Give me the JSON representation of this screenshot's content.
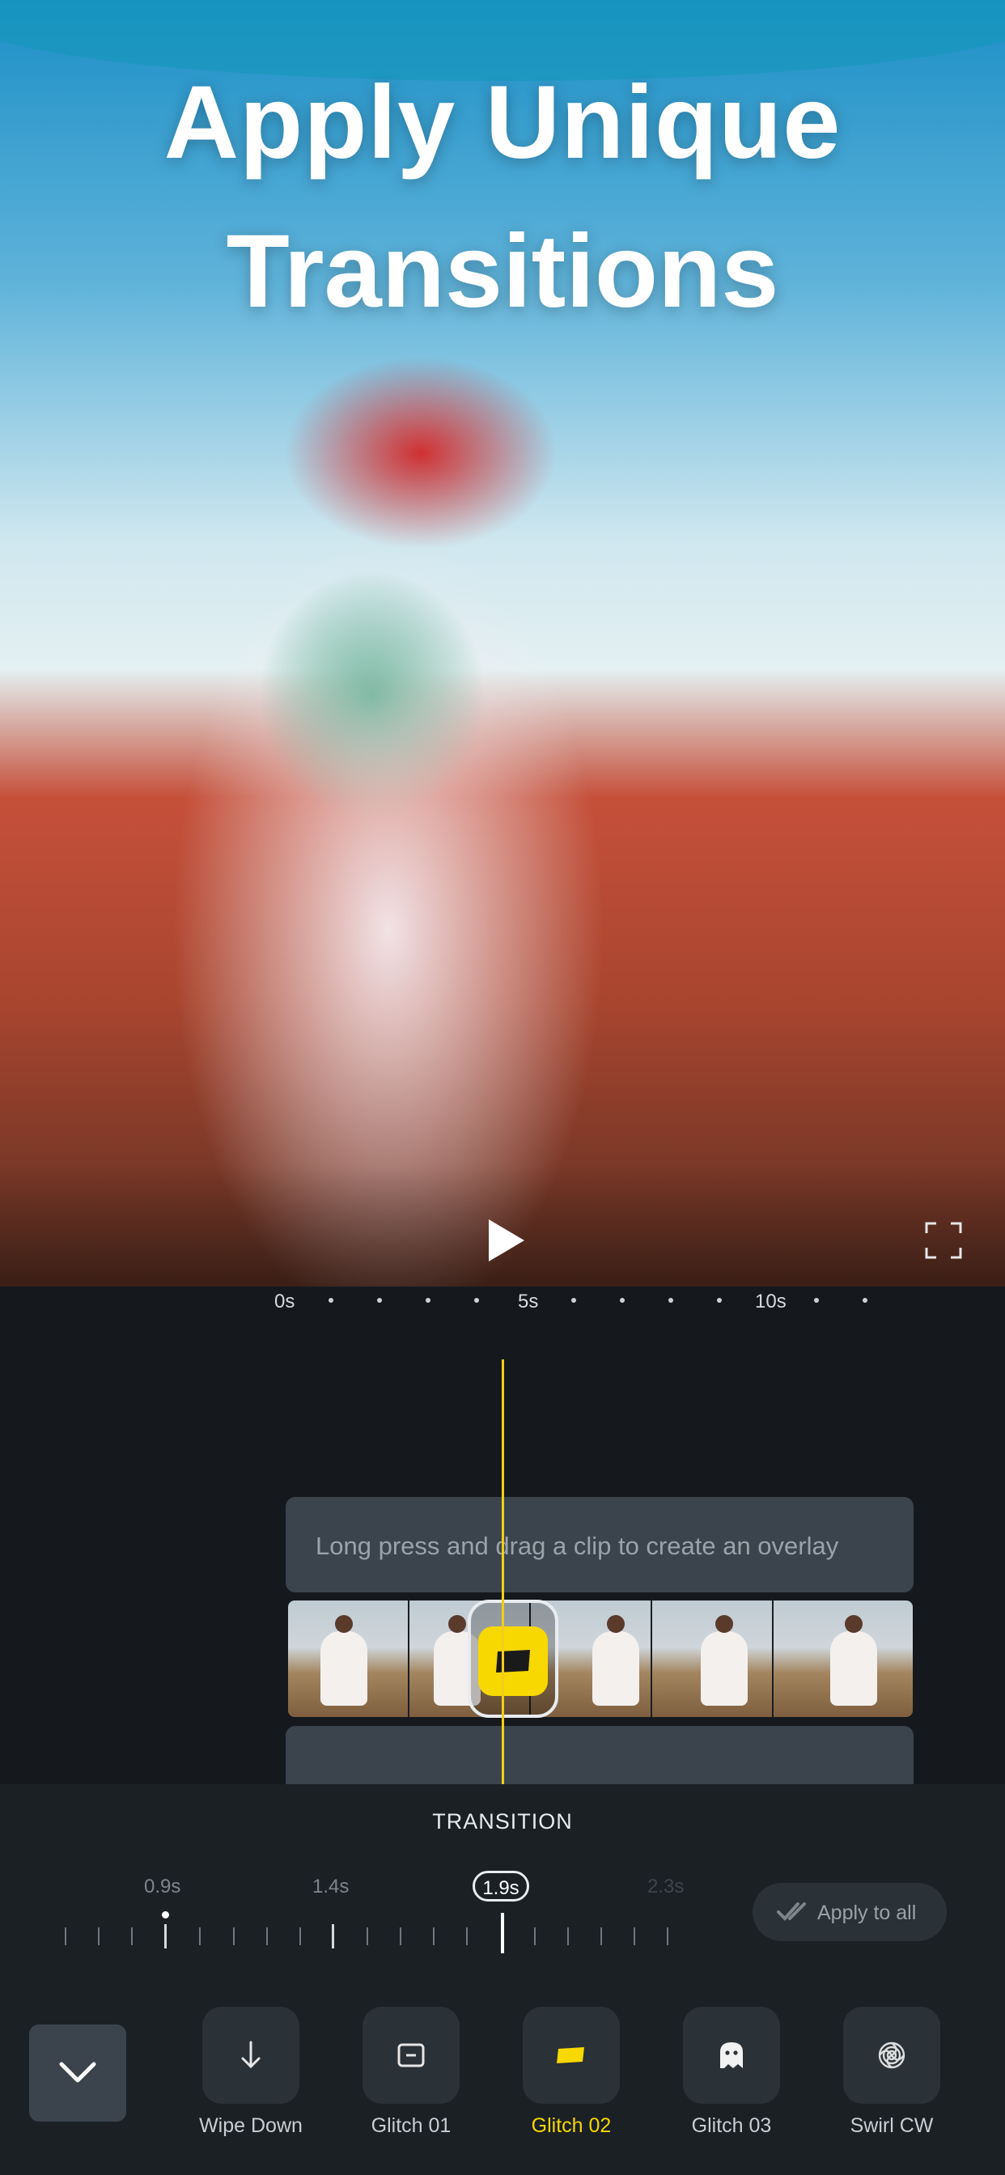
{
  "headline": {
    "line1": "Apply Unique",
    "line2": "Transitions"
  },
  "player": {
    "play_icon": "play-icon",
    "fullscreen_icon": "fullscreen-icon"
  },
  "ruler": {
    "labels": [
      "0s",
      "5s",
      "10s"
    ]
  },
  "timeline": {
    "overlay_hint": "Long press and drag a clip to create an overlay",
    "transition_marker_icon": "glitch-02-icon"
  },
  "panel": {
    "title": "TRANSITION",
    "durations": [
      "0.9s",
      "1.4s",
      "1.9s",
      "2.3s"
    ],
    "selected_duration": "1.9s",
    "apply_all": "Apply to all",
    "collapse_icon": "chevron-down-icon",
    "transitions": [
      {
        "label": "Wipe Down",
        "icon": "arrow-down-icon"
      },
      {
        "label": "Glitch 01",
        "icon": "glitch-01-icon"
      },
      {
        "label": "Glitch 02",
        "icon": "glitch-02-icon",
        "selected": true
      },
      {
        "label": "Glitch 03",
        "icon": "ghost-icon"
      },
      {
        "label": "Swirl CW",
        "icon": "swirl-icon"
      }
    ]
  },
  "colors": {
    "accent": "#F7D800",
    "background": "#15191D",
    "panel": "#1B2025",
    "playhead": "#F0CD1D"
  }
}
